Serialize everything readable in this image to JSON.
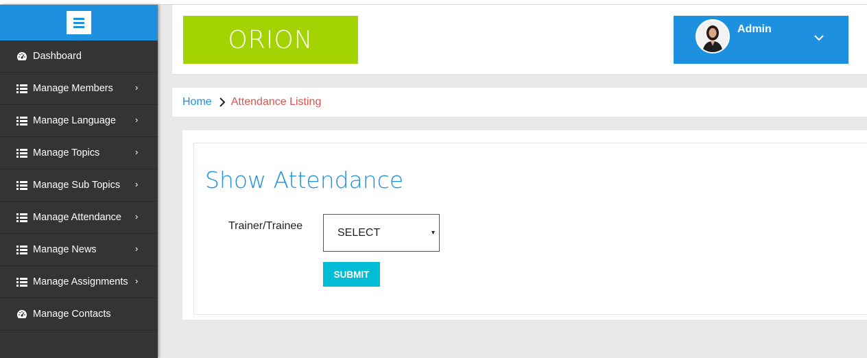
{
  "sidebar": {
    "items": [
      {
        "label": "Dashboard",
        "icon": "dashboard-icon",
        "has_submenu": false
      },
      {
        "label": "Manage Members",
        "icon": "list-icon",
        "has_submenu": true
      },
      {
        "label": "Manage Language",
        "icon": "list-icon",
        "has_submenu": true
      },
      {
        "label": "Manage Topics",
        "icon": "list-icon",
        "has_submenu": true
      },
      {
        "label": "Manage Sub Topics",
        "icon": "list-icon",
        "has_submenu": true
      },
      {
        "label": "Manage Attendance",
        "icon": "list-icon",
        "has_submenu": true
      },
      {
        "label": "Manage News",
        "icon": "list-icon",
        "has_submenu": true
      },
      {
        "label": "Manage Assignments",
        "icon": "list-icon",
        "has_submenu": true
      },
      {
        "label": "Manage Contacts",
        "icon": "dashboard-icon",
        "has_submenu": false
      }
    ],
    "submenu_glyph": "›"
  },
  "header": {
    "logo_text": "ORION",
    "user_name": "Admin"
  },
  "breadcrumb": {
    "home": "Home",
    "current": "Attendance Listing"
  },
  "main": {
    "title": "Show Attendance",
    "field_label": "Trainer/Trainee",
    "select_value": "SELECT",
    "select_caret": "▾",
    "submit_label": "SUBMIT"
  },
  "colors": {
    "accent": "#1e90e0",
    "logo_bg": "#a3d300",
    "sidebar_bg": "#343434",
    "submit_bg": "#00bcd4",
    "breadcrumb_current": "#d9534f"
  }
}
